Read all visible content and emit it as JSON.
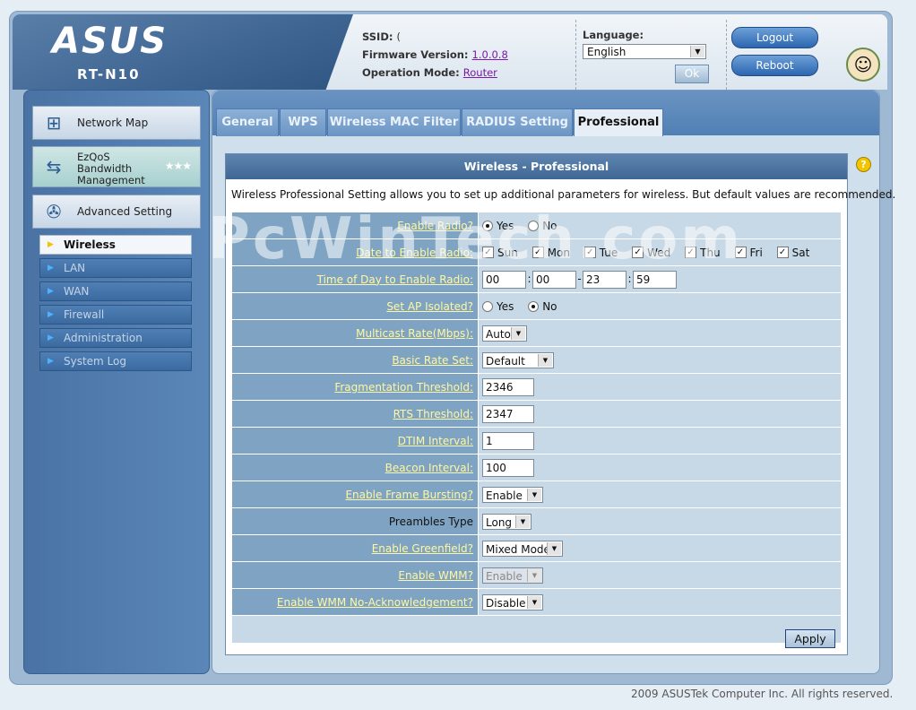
{
  "header": {
    "brand": "ASUS",
    "model": "RT-N10",
    "ssid_label": "SSID:",
    "ssid_value": "(",
    "firmware_label": "Firmware Version:",
    "firmware_value": "1.0.0.8",
    "mode_label": "Operation Mode:",
    "mode_value": "Router",
    "language_label": "Language:",
    "language_value": "English",
    "ok_label": "Ok",
    "logout_label": "Logout",
    "reboot_label": "Reboot"
  },
  "sidebar": {
    "network_map": "Network Map",
    "ezqos": [
      "EzQoS",
      "Bandwidth",
      "Management"
    ],
    "advanced": "Advanced Setting",
    "items": [
      "Wireless",
      "LAN",
      "WAN",
      "Firewall",
      "Administration",
      "System Log"
    ]
  },
  "tabs": [
    "General",
    "WPS",
    "Wireless MAC Filter",
    "RADIUS Setting",
    "Professional"
  ],
  "content": {
    "title": "Wireless - Professional",
    "description": "Wireless Professional Setting allows you to set up additional parameters for wireless. But default values are recommended."
  },
  "form": {
    "enable_radio_label": "Enable Radio?",
    "yes": "Yes",
    "no": "No",
    "date_label": "Date to Enable Radio:",
    "days": [
      "Sun",
      "Mon",
      "Tue",
      "Wed",
      "Thu",
      "Fri",
      "Sat"
    ],
    "time_label": "Time of Day to Enable Radio:",
    "time_values": [
      "00",
      "00",
      "23",
      "59"
    ],
    "ap_isolated_label": "Set AP Isolated?",
    "multicast_label": "Multicast Rate(Mbps):",
    "multicast_value": "Auto",
    "basic_rate_label": "Basic Rate Set:",
    "basic_rate_value": "Default",
    "frag_label": "Fragmentation Threshold:",
    "frag_value": "2346",
    "rts_label": "RTS Threshold:",
    "rts_value": "2347",
    "dtim_label": "DTIM Interval:",
    "dtim_value": "1",
    "beacon_label": "Beacon Interval:",
    "beacon_value": "100",
    "frame_burst_label": "Enable Frame Bursting?",
    "frame_burst_value": "Enable",
    "preambles_label": "Preambles Type",
    "preambles_value": "Long",
    "greenfield_label": "Enable Greenfield?",
    "greenfield_value": "Mixed Mode",
    "wmm_label": "Enable WMM?",
    "wmm_value": "Enable",
    "wmm_noack_label": "Enable WMM No-Acknowledgement?",
    "wmm_noack_value": "Disable",
    "apply_label": "Apply"
  },
  "watermark": "PcWinTech.com",
  "footer": "2009 ASUSTek Computer Inc. All rights reserved."
}
